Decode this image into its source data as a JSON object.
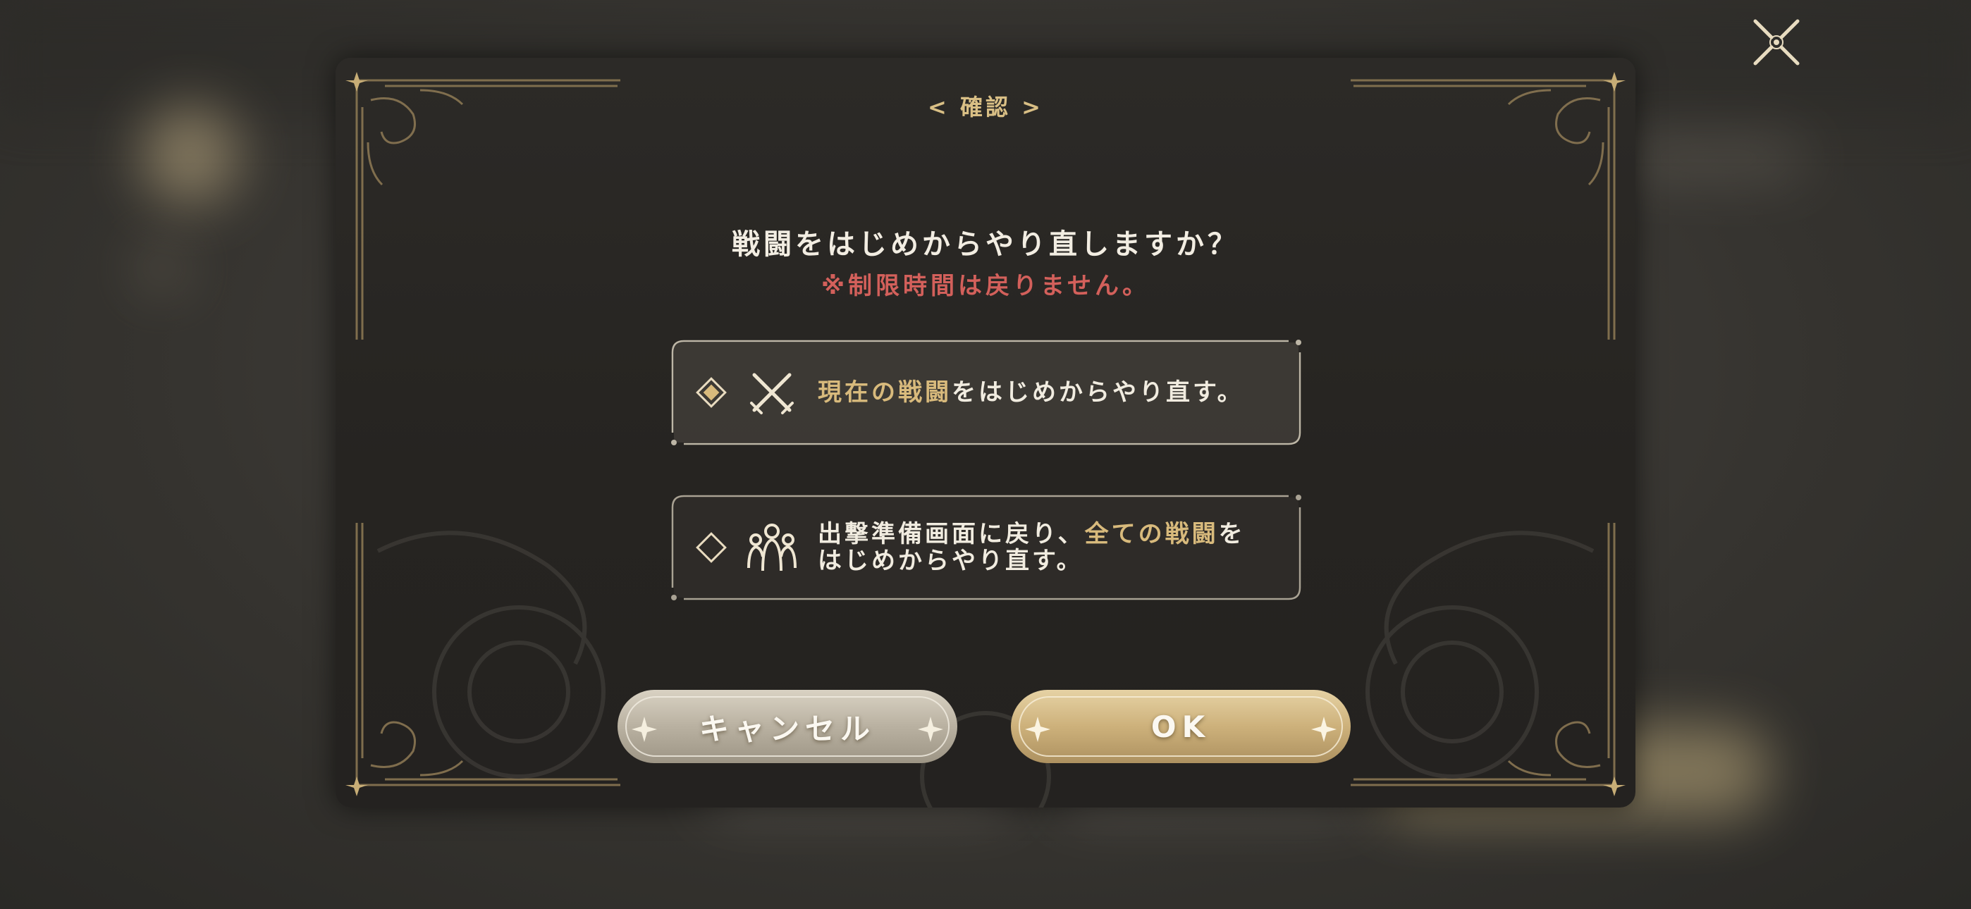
{
  "dialog": {
    "title": "< 確認 >",
    "question": "戦闘をはじめからやり直しますか？",
    "note": "※制限時間は戻りません。"
  },
  "options": [
    {
      "icon": "crossed-swords-icon",
      "selected": true,
      "highlight": "現在の戦闘",
      "rest": "をはじめからやり直す。"
    },
    {
      "icon": "party-members-icon",
      "selected": false,
      "line1_a": "出撃準備画面に戻り、",
      "line1_highlight": "全ての戦闘",
      "line1_b": "を",
      "line2": "はじめからやり直す。"
    }
  ],
  "buttons": {
    "cancel_label": "キャンセル",
    "ok_label": "OK"
  },
  "colors": {
    "gold": "#d8ba7c",
    "warning": "#d3605b",
    "text": "#f1ece0",
    "dialog_bg": "#282623"
  }
}
